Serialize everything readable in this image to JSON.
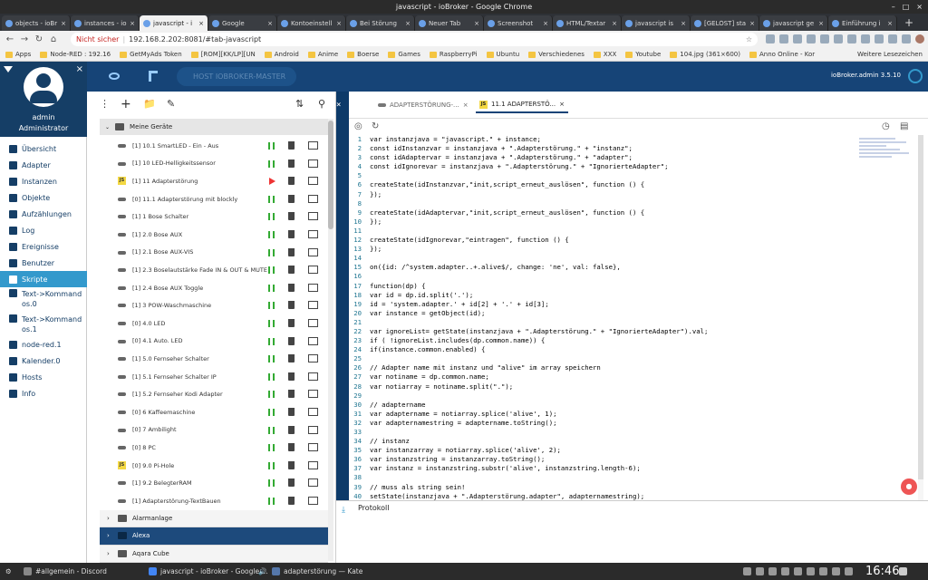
{
  "window": {
    "title": "javascript - ioBroker - Google Chrome"
  },
  "browser_tabs": [
    {
      "label": "objects - ioBr"
    },
    {
      "label": "instances - io"
    },
    {
      "label": "javascript - i",
      "active": true
    },
    {
      "label": "Google"
    },
    {
      "label": "Kontoeinstell"
    },
    {
      "label": "Bei Störung"
    },
    {
      "label": "Neuer Tab"
    },
    {
      "label": "Screenshot"
    },
    {
      "label": "HTML/Textar"
    },
    {
      "label": "javascript is"
    },
    {
      "label": "[GELÖST] sta"
    },
    {
      "label": "javascript ge"
    },
    {
      "label": "Einführung i"
    }
  ],
  "address": {
    "warning": "Nicht sicher",
    "url": "192.168.2.202:8081/#tab-javascript"
  },
  "bookmarks": [
    "Apps",
    "Node-RED : 192.16",
    "GetMyAds Token",
    "[ROM][KK/LP][UN",
    "Android",
    "Anime",
    "Boerse",
    "Games",
    "RaspberryPi",
    "Ubuntu",
    "Verschiedenes",
    "XXX",
    "Youtube",
    "104.jpg (361×600)",
    "Anno Online - Kor"
  ],
  "bookmarks_more": "Weitere Lesezeichen",
  "sidebar": {
    "user": "admin",
    "role": "Administrator",
    "items": [
      {
        "label": "Übersicht",
        "icon": "grid-icon"
      },
      {
        "label": "Adapter",
        "icon": "puzzle-icon"
      },
      {
        "label": "Instanzen",
        "icon": "list-icon"
      },
      {
        "label": "Objekte",
        "icon": "table-icon"
      },
      {
        "label": "Aufzählungen",
        "icon": "list-icon"
      },
      {
        "label": "Log",
        "icon": "menu-icon"
      },
      {
        "label": "Ereignisse",
        "icon": "bolt-icon"
      },
      {
        "label": "Benutzer",
        "icon": "user-icon"
      },
      {
        "label": "Skripte",
        "icon": "code-icon",
        "active": true
      },
      {
        "label": "Text->Kommandos.0",
        "icon": "gear-icon"
      },
      {
        "label": "Text->Kommandos.1",
        "icon": "gear-icon"
      },
      {
        "label": "node-red.1",
        "icon": "node-icon"
      },
      {
        "label": "Kalender.0",
        "icon": "calendar-icon"
      },
      {
        "label": "Hosts",
        "icon": "host-icon"
      },
      {
        "label": "Info",
        "icon": "info-icon"
      }
    ]
  },
  "topbar": {
    "host": "HOST IOBROKER-MASTER",
    "version": "ioBroker.admin 3.5.10"
  },
  "tree": {
    "root": "Meine Geräte",
    "rows": [
      {
        "name": "[1] 10.1 SmartLED - Ein - Aus",
        "type": "adp",
        "state": "run"
      },
      {
        "name": "[1] 10 LED-Helligkeitssensor",
        "type": "adp",
        "state": "run"
      },
      {
        "name": "[1] 11 Adapterstörung",
        "type": "js",
        "state": "play"
      },
      {
        "name": "[0] 11.1 Adapterstörung mit blockly",
        "type": "adp",
        "state": "run"
      },
      {
        "name": "[1] 1 Bose Schalter",
        "type": "adp",
        "state": "run"
      },
      {
        "name": "[1] 2.0 Bose AUX",
        "type": "adp",
        "state": "run"
      },
      {
        "name": "[1] 2.1 Bose AUX-VIS",
        "type": "adp",
        "state": "run"
      },
      {
        "name": "[1] 2.3 Boselautstärke Fade IN & OUT & MUTE",
        "type": "adp",
        "state": "run"
      },
      {
        "name": "[1] 2.4 Bose AUX Toggle",
        "type": "adp",
        "state": "run"
      },
      {
        "name": "[1] 3 POW-Waschmaschine",
        "type": "adp",
        "state": "run"
      },
      {
        "name": "[0] 4.0 LED",
        "type": "adp",
        "state": "run"
      },
      {
        "name": "[0] 4.1 Auto. LED",
        "type": "adp",
        "state": "run"
      },
      {
        "name": "[1] 5.0 Fernseher Schalter",
        "type": "adp",
        "state": "run"
      },
      {
        "name": "[1] 5.1 Fernseher Schalter IP",
        "type": "adp",
        "state": "run"
      },
      {
        "name": "[1] 5.2 Fernseher Kodi Adapter",
        "type": "adp",
        "state": "run"
      },
      {
        "name": "[0] 6 Kaffeemaschine",
        "type": "adp",
        "state": "run"
      },
      {
        "name": "[0] 7 Ambilight",
        "type": "adp",
        "state": "run"
      },
      {
        "name": "[0] 8 PC",
        "type": "adp",
        "state": "run"
      },
      {
        "name": "[0] 9.0 Pi-Hole",
        "type": "js",
        "state": "run"
      },
      {
        "name": "[1] 9.2 BelegterRAM",
        "type": "adp",
        "state": "run"
      },
      {
        "name": "[1] Adapterstörung-TextBauen",
        "type": "adp",
        "state": "run"
      }
    ],
    "groups": [
      {
        "name": "Alarmanlage",
        "selected": false
      },
      {
        "name": "Alexa",
        "selected": true
      },
      {
        "name": "Aqara Cube",
        "selected": false
      }
    ]
  },
  "editor": {
    "tabs": [
      {
        "label": "ADAPTERSTÖRUNG-...",
        "type": "adp"
      },
      {
        "label": "11.1 ADAPTERSTÖ...",
        "type": "js",
        "active": true
      }
    ],
    "code": [
      "var instanzjava = \"javascript.\" + instance;",
      "const idInstanzvar = instanzjava + \".Adapterstörung.\" + \"instanz\";",
      "const idAdaptervar = instanzjava + \".Adapterstörung.\" + \"adapter\";",
      "const idIgnorevar = instanzjava + \".Adapterstörung.\" + \"IgnorierteAdapter\";",
      "",
      "createState(idInstanzvar,\"init,script_erneut_auslösen\", function () {",
      "});",
      "",
      "createState(idAdaptervar,\"init,script_erneut_auslösen\", function () {",
      "});",
      "",
      "createState(idIgnorevar,\"eintragen\", function () {",
      "});",
      "",
      "on({id: /^system.adapter..+.alive$/, change: 'ne', val: false},",
      "",
      "function(dp) {",
      "var id = dp.id.split('.');",
      "id = 'system.adapter.' + id[2] + '.' + id[3];",
      "var instance = getObject(id);",
      "",
      "var ignoreList= getState(instanzjava + \".Adapterstörung.\" + \"IgnorierteAdapter\").val;",
      "if ( !ignoreList.includes(dp.common.name)) {",
      "if(instance.common.enabled) {",
      "",
      "// Adapter name mit instanz und \"alive\" im array speichern",
      "var notiname = dp.common.name;",
      "var notiarray = notiname.split(\".\");",
      "",
      "// adaptername",
      "var adaptername = notiarray.splice('alive', 1);",
      "var adapternamestring = adaptername.toString();",
      "",
      "// instanz",
      "var instanzarray = notiarray.splice('alive', 2);",
      "var instanzstring = instanzarray.toString();",
      "var instanz = instanzstring.substr('alive', instanzstring.length-6);",
      "",
      "// muss als string sein!",
      "setState(instanzjava + \".Adapterstörung.adapter\", adapternamestring);"
    ]
  },
  "log_panel": {
    "label": "Protokoll"
  },
  "taskbar": {
    "items": [
      "#allgemein - Discord",
      "javascript - ioBroker - Google ...",
      "adapterstörung — Kate"
    ],
    "clock": "16:46"
  }
}
